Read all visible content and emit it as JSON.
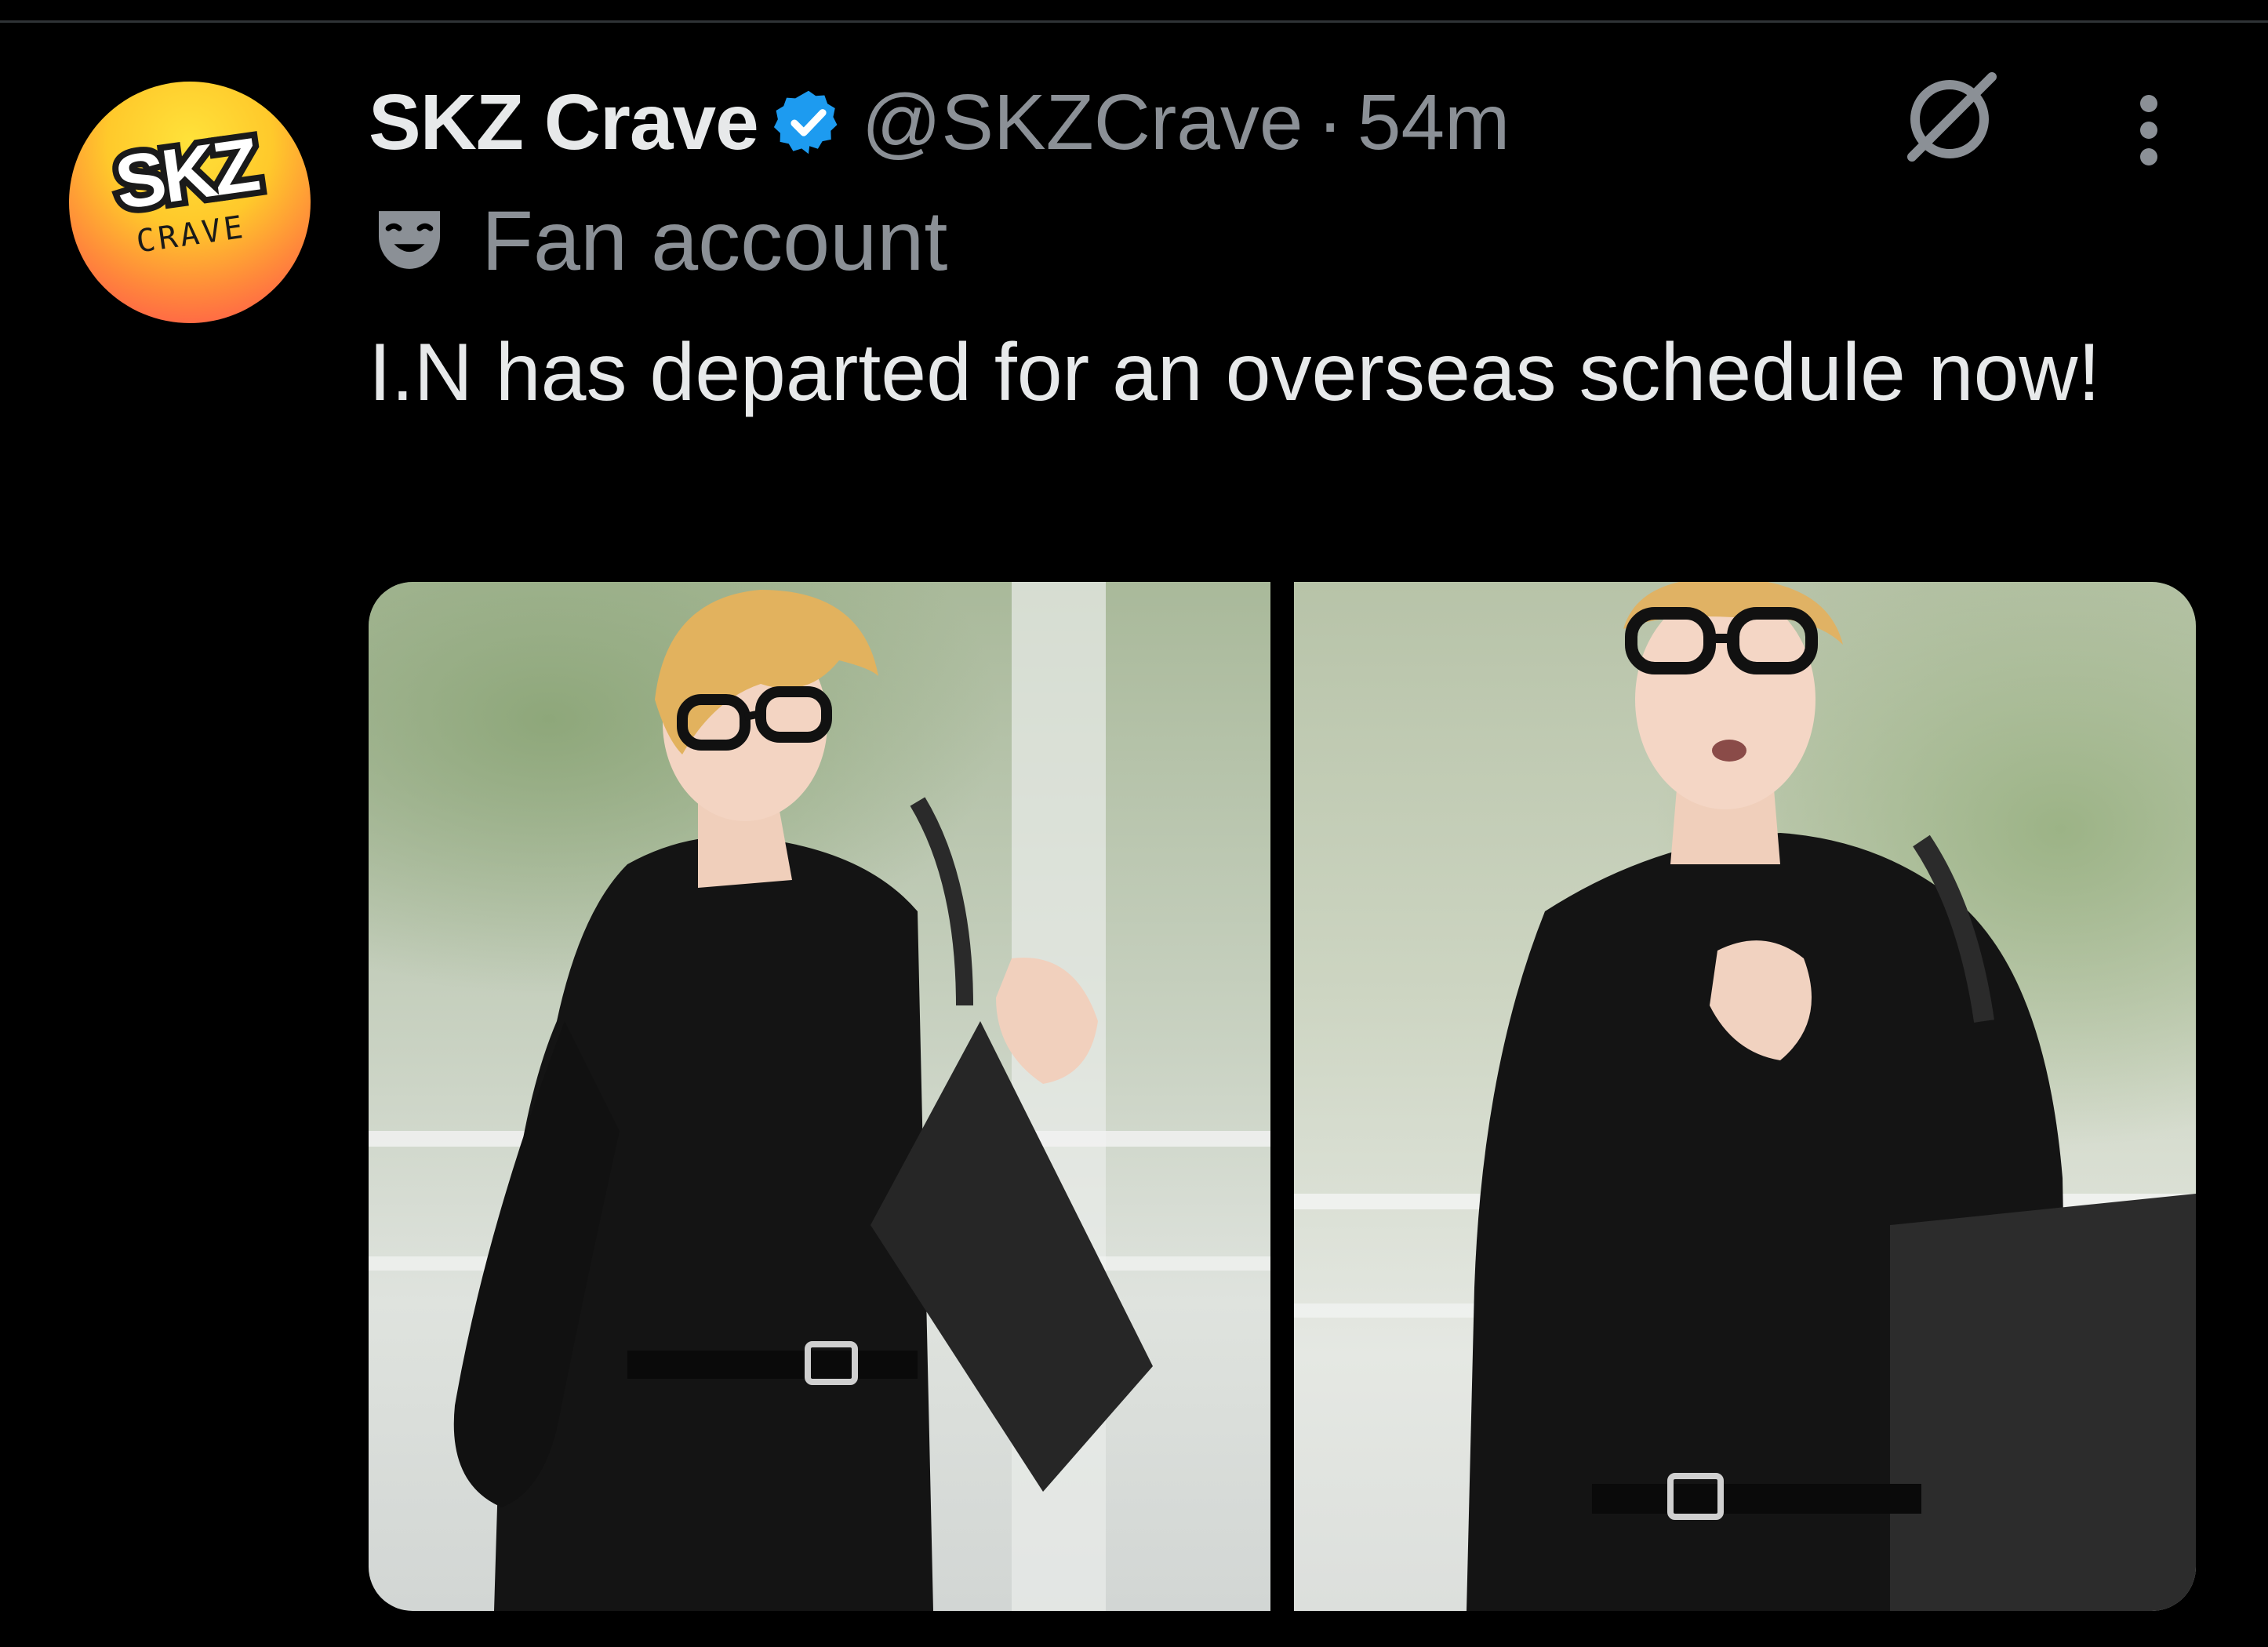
{
  "account": {
    "display_name": "SKZ Crave",
    "handle": "@SKZCrave",
    "separator": "·",
    "time_ago": "54m",
    "verified": true,
    "label": "Fan account",
    "avatar_text_top": "SKZ",
    "avatar_text_bottom": "CRAVE"
  },
  "tweet": {
    "text": "I.N has departed for an overseas schedule now!"
  },
  "media": {
    "photos": [
      {
        "name": "photo-1"
      },
      {
        "name": "photo-2"
      }
    ]
  },
  "icons": {
    "verified": "verified-badge-icon",
    "label": "mask-icon",
    "grok": "grok-icon",
    "more": "more-options-icon"
  },
  "colors": {
    "background": "#000000",
    "text_primary": "#e7e9ea",
    "text_secondary": "#8b9096",
    "verified_blue": "#1d9bf0"
  }
}
